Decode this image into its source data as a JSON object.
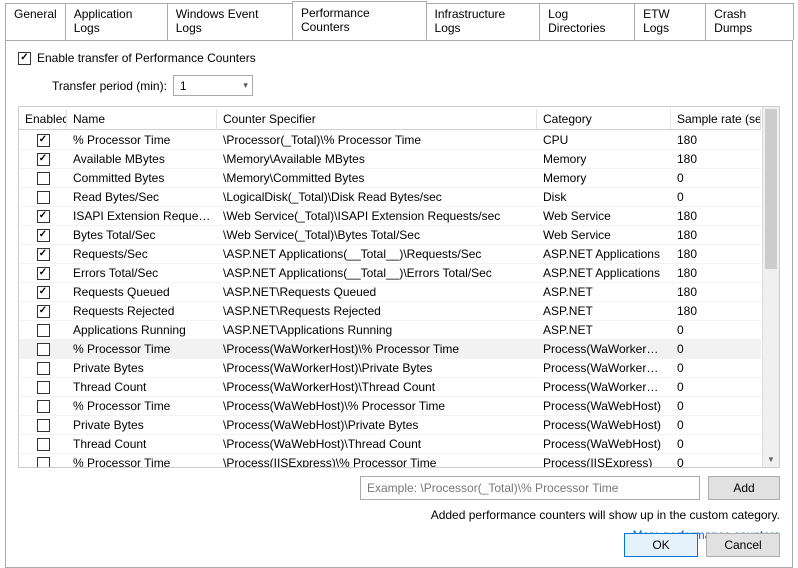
{
  "tabs": {
    "general": "General",
    "app_logs": "Application Logs",
    "win_event_logs": "Windows Event Logs",
    "perf_counters": "Performance Counters",
    "infra_logs": "Infrastructure Logs",
    "log_dirs": "Log Directories",
    "etw_logs": "ETW Logs",
    "crash_dumps": "Crash Dumps"
  },
  "panel": {
    "enable_label": "Enable transfer of Performance Counters",
    "transfer_label": "Transfer period (min):",
    "transfer_value": "1"
  },
  "grid": {
    "head": {
      "enabled": "Enabled",
      "name": "Name",
      "spec": "Counter Specifier",
      "category": "Category",
      "rate": "Sample rate (sec)"
    },
    "rows": [
      {
        "en": true,
        "name": "% Processor Time",
        "spec": "\\Processor(_Total)\\% Processor Time",
        "cat": "CPU",
        "rate": "180"
      },
      {
        "en": true,
        "name": "Available MBytes",
        "spec": "\\Memory\\Available MBytes",
        "cat": "Memory",
        "rate": "180"
      },
      {
        "en": false,
        "name": "Committed Bytes",
        "spec": "\\Memory\\Committed Bytes",
        "cat": "Memory",
        "rate": "0"
      },
      {
        "en": false,
        "name": "Read Bytes/Sec",
        "spec": "\\LogicalDisk(_Total)\\Disk Read Bytes/sec",
        "cat": "Disk",
        "rate": "0"
      },
      {
        "en": true,
        "name": "ISAPI Extension Requests/...",
        "spec": "\\Web Service(_Total)\\ISAPI Extension Requests/sec",
        "cat": "Web Service",
        "rate": "180"
      },
      {
        "en": true,
        "name": "Bytes Total/Sec",
        "spec": "\\Web Service(_Total)\\Bytes Total/Sec",
        "cat": "Web Service",
        "rate": "180"
      },
      {
        "en": true,
        "name": "Requests/Sec",
        "spec": "\\ASP.NET Applications(__Total__)\\Requests/Sec",
        "cat": "ASP.NET Applications",
        "rate": "180"
      },
      {
        "en": true,
        "name": "Errors Total/Sec",
        "spec": "\\ASP.NET Applications(__Total__)\\Errors Total/Sec",
        "cat": "ASP.NET Applications",
        "rate": "180"
      },
      {
        "en": true,
        "name": "Requests Queued",
        "spec": "\\ASP.NET\\Requests Queued",
        "cat": "ASP.NET",
        "rate": "180"
      },
      {
        "en": true,
        "name": "Requests Rejected",
        "spec": "\\ASP.NET\\Requests Rejected",
        "cat": "ASP.NET",
        "rate": "180"
      },
      {
        "en": false,
        "name": "Applications Running",
        "spec": "\\ASP.NET\\Applications Running",
        "cat": "ASP.NET",
        "rate": "0"
      },
      {
        "en": false,
        "name": "% Processor Time",
        "spec": "\\Process(WaWorkerHost)\\% Processor Time",
        "cat": "Process(WaWorkerHost)",
        "rate": "0",
        "sel": true
      },
      {
        "en": false,
        "name": "Private Bytes",
        "spec": "\\Process(WaWorkerHost)\\Private Bytes",
        "cat": "Process(WaWorkerHost)",
        "rate": "0"
      },
      {
        "en": false,
        "name": "Thread Count",
        "spec": "\\Process(WaWorkerHost)\\Thread Count",
        "cat": "Process(WaWorkerHost)",
        "rate": "0"
      },
      {
        "en": false,
        "name": "% Processor Time",
        "spec": "\\Process(WaWebHost)\\% Processor Time",
        "cat": "Process(WaWebHost)",
        "rate": "0"
      },
      {
        "en": false,
        "name": "Private Bytes",
        "spec": "\\Process(WaWebHost)\\Private Bytes",
        "cat": "Process(WaWebHost)",
        "rate": "0"
      },
      {
        "en": false,
        "name": "Thread Count",
        "spec": "\\Process(WaWebHost)\\Thread Count",
        "cat": "Process(WaWebHost)",
        "rate": "0"
      },
      {
        "en": false,
        "name": "% Processor Time",
        "spec": "\\Process(IISExpress)\\% Processor Time",
        "cat": "Process(IISExpress)",
        "rate": "0"
      }
    ]
  },
  "add": {
    "placeholder": "Example: \\Processor(_Total)\\% Processor Time",
    "button": "Add",
    "note": "Added performance counters will show up in the custom category.",
    "link": "More performance counters"
  },
  "dialog": {
    "ok": "OK",
    "cancel": "Cancel"
  }
}
